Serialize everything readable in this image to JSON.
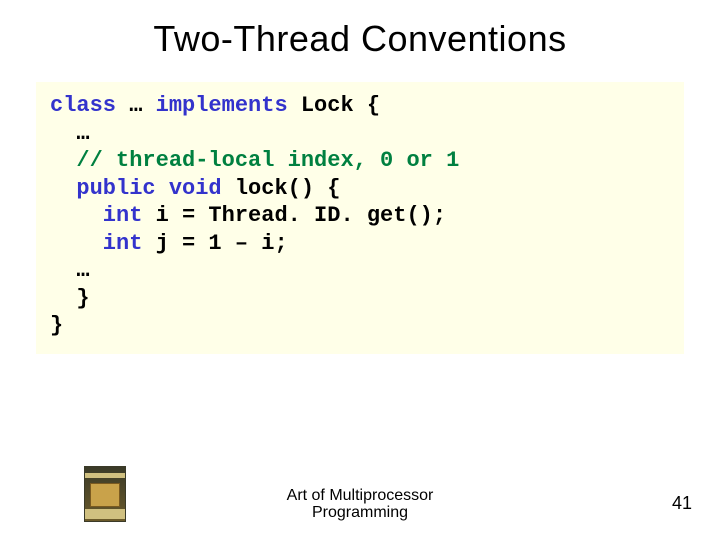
{
  "title": "Two-Thread Conventions",
  "code": {
    "l1a": "class",
    "l1b": " … ",
    "l1c": "implements",
    "l1d": " Lock {",
    "l2": "  …",
    "l3": "  // thread-local index, 0 or 1",
    "l4a": "  public void",
    "l4b": " lock() {",
    "l5a": "    int",
    "l5b": " i = Thread. ID. get();",
    "l6a": "    int",
    "l6b": " j = 1 – i;",
    "l7": "  …",
    "l8": "  }",
    "l9": "}"
  },
  "footer": {
    "line1": "Art of Multiprocessor",
    "line2": "Programming"
  },
  "page_number": "41"
}
